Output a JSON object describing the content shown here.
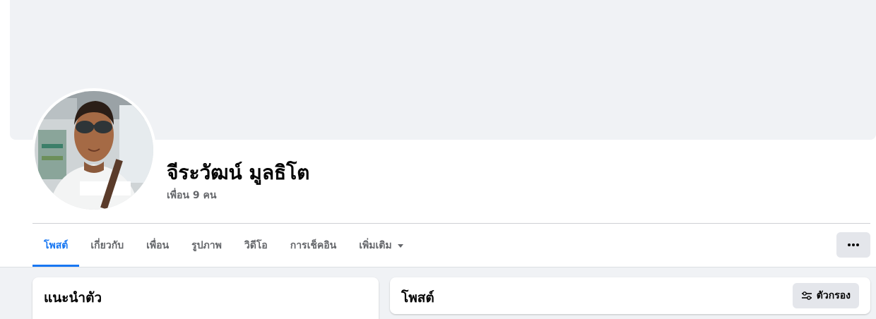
{
  "profile": {
    "name": "จีระวัฒน์ มูลธิโต",
    "friends_count_text": "เพื่อน 9 คน"
  },
  "tabs": [
    {
      "label": "โพสต์",
      "active": true
    },
    {
      "label": "เกี่ยวกับ",
      "active": false
    },
    {
      "label": "เพื่อน",
      "active": false
    },
    {
      "label": "รูปภาพ",
      "active": false
    },
    {
      "label": "วิดีโอ",
      "active": false
    },
    {
      "label": "การเช็คอิน",
      "active": false
    },
    {
      "label": "เพิ่มเติม",
      "active": false
    }
  ],
  "intro_card": {
    "title": "แนะนำตัว"
  },
  "posts_card": {
    "title": "โพสต์",
    "filter_label": "ตัวกรอง"
  },
  "colors": {
    "accent": "#1877f2",
    "background": "#f0f2f5",
    "secondary_text": "#65676b",
    "button_gray": "#e4e6eb"
  },
  "icons": {
    "more": "more-dots-icon",
    "filter": "filter-sliders-icon",
    "dropdown": "caret-down-icon"
  }
}
